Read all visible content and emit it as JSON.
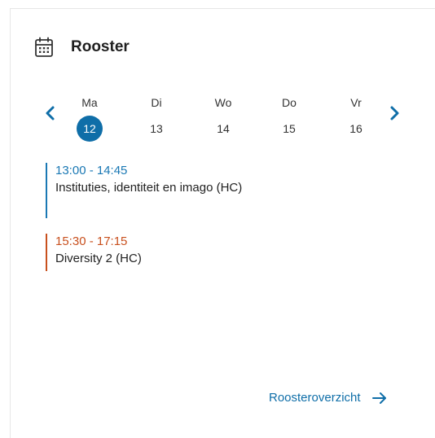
{
  "widget": {
    "title": "Rooster",
    "icon": "calendar-icon"
  },
  "week": {
    "days": [
      {
        "name": "Ma",
        "number": "12",
        "selected": true
      },
      {
        "name": "Di",
        "number": "13",
        "selected": false
      },
      {
        "name": "Wo",
        "number": "14",
        "selected": false
      },
      {
        "name": "Do",
        "number": "15",
        "selected": false
      },
      {
        "name": "Vr",
        "number": "16",
        "selected": false
      }
    ],
    "prev_icon": "chevron-left-icon",
    "next_icon": "chevron-right-icon"
  },
  "events": [
    {
      "time": "13:00 - 14:45",
      "title": "Instituties, identiteit en imago (HC)",
      "color": "#1a78b4"
    },
    {
      "time": "15:30 - 17:15",
      "title": "Diversity 2 (HC)",
      "color": "#c8501e"
    }
  ],
  "footer": {
    "link_label": "Roosteroverzicht",
    "arrow_icon": "arrow-right-icon"
  },
  "colors": {
    "accent": "#0f6ea8",
    "text": "#1f1f1f"
  }
}
